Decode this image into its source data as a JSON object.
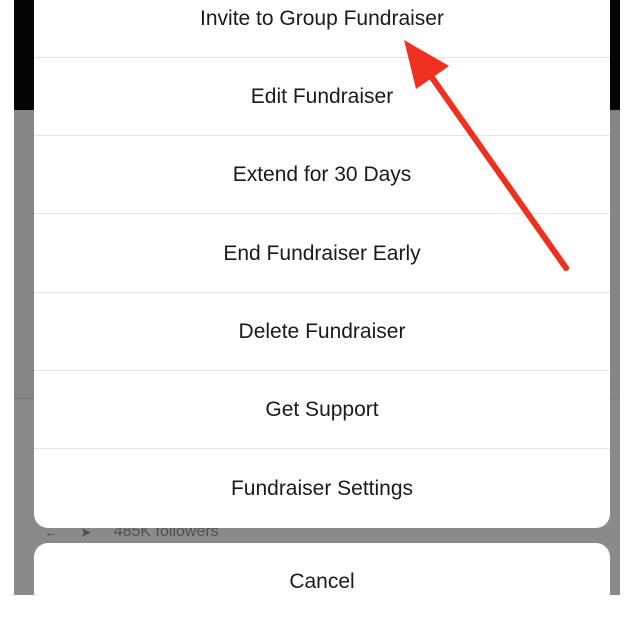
{
  "profile": {
    "followers_text": "485K followers"
  },
  "action_sheet": {
    "items": [
      {
        "label": "Invite to Group Fundraiser"
      },
      {
        "label": "Edit Fundraiser"
      },
      {
        "label": "Extend for 30 Days"
      },
      {
        "label": "End Fundraiser Early"
      },
      {
        "label": "Delete Fundraiser"
      },
      {
        "label": "Get Support"
      },
      {
        "label": "Fundraiser Settings"
      }
    ],
    "cancel_label": "Cancel"
  },
  "colors": {
    "annotation_arrow": "#f0301e",
    "overlay_dim": "#858585",
    "sheet_background": "#ffffff"
  }
}
